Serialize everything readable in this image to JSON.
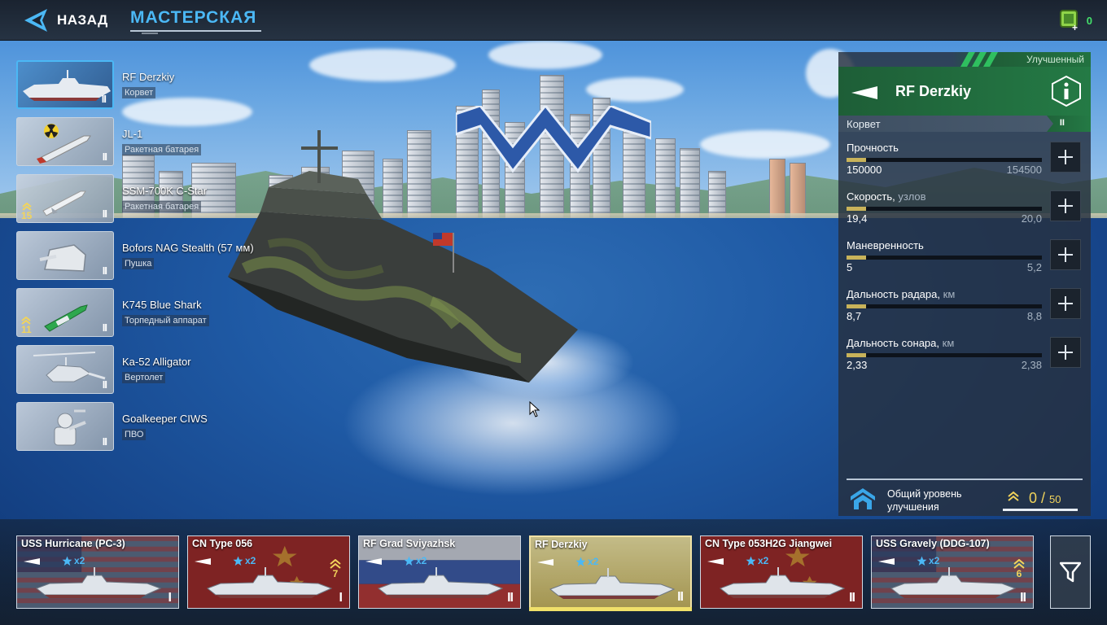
{
  "topbar": {
    "back_label": "НАЗАД",
    "tab_title": "МАСТЕРСКАЯ",
    "currency_value": "0"
  },
  "equipment": [
    {
      "name": "RF Derzkiy",
      "type": "Корвет",
      "tier": "II",
      "level": "",
      "selected": true,
      "icon": "corvette-icon"
    },
    {
      "name": "JL-1",
      "type": "Ракетная батарея",
      "tier": "II",
      "level": "",
      "icon": "nuclear-missile-icon"
    },
    {
      "name": "SSM-700K C-Star",
      "type": "Ракетная батарея",
      "tier": "II",
      "level": "15",
      "icon": "missile-icon"
    },
    {
      "name": "Bofors NAG Stealth (57 мм)",
      "type": "Пушка",
      "tier": "II",
      "level": "",
      "icon": "naval-gun-icon"
    },
    {
      "name": "K745 Blue Shark",
      "type": "Торпедный аппарат",
      "tier": "II",
      "level": "11",
      "icon": "torpedo-icon"
    },
    {
      "name": "Ka-52 Alligator",
      "type": "Вертолет",
      "tier": "II",
      "level": "",
      "icon": "helicopter-icon"
    },
    {
      "name": "Goalkeeper CIWS",
      "type": "ПВО",
      "tier": "II",
      "level": "",
      "icon": "ciws-icon"
    }
  ],
  "panel": {
    "tag": "Улучшенный",
    "ship_name": "RF Derzkiy",
    "ship_class": "Корвет",
    "tier": "II",
    "stats": [
      {
        "name": "Прочность",
        "unit": "",
        "current": "150000",
        "max": "154500",
        "fill": 0.1
      },
      {
        "name": "Скорость,",
        "unit": "узлов",
        "current": "19,4",
        "max": "20,0",
        "fill": 0.1
      },
      {
        "name": "Маневренность",
        "unit": "",
        "current": "5",
        "max": "5,2",
        "fill": 0.1
      },
      {
        "name": "Дальность радара,",
        "unit": "км",
        "current": "8,7",
        "max": "8,8",
        "fill": 0.1
      },
      {
        "name": "Дальность сонара,",
        "unit": "км",
        "current": "2,33",
        "max": "2,38",
        "fill": 0.1
      }
    ],
    "upgrade_label": "Общий уровень улучшения",
    "upgrade_current": "0",
    "upgrade_max": "50"
  },
  "ships": [
    {
      "name": "USS Hurricane (PC-3)",
      "stars": "x2",
      "tier": "I",
      "level": "",
      "flag": "usa"
    },
    {
      "name": "CN Type 056",
      "stars": "x2",
      "tier": "I",
      "level": "7",
      "flag": "china"
    },
    {
      "name": "RF Grad Sviyazhsk",
      "stars": "x2",
      "tier": "II",
      "level": "",
      "flag": "russia"
    },
    {
      "name": "RF Derzkiy",
      "stars": "x2",
      "tier": "II",
      "level": "",
      "flag": "selected",
      "selected": true
    },
    {
      "name": "CN Type 053H2G Jiangwei",
      "stars": "x2",
      "tier": "II",
      "level": "",
      "flag": "china"
    },
    {
      "name": "USS Gravely (DDG-107)",
      "stars": "x2",
      "tier": "II",
      "level": "6",
      "flag": "usa"
    }
  ],
  "colors": {
    "accent_blue": "#4bb8f5",
    "panel_green": "#247a45",
    "gold": "#f2d45b",
    "currency_green": "#44e06b"
  }
}
